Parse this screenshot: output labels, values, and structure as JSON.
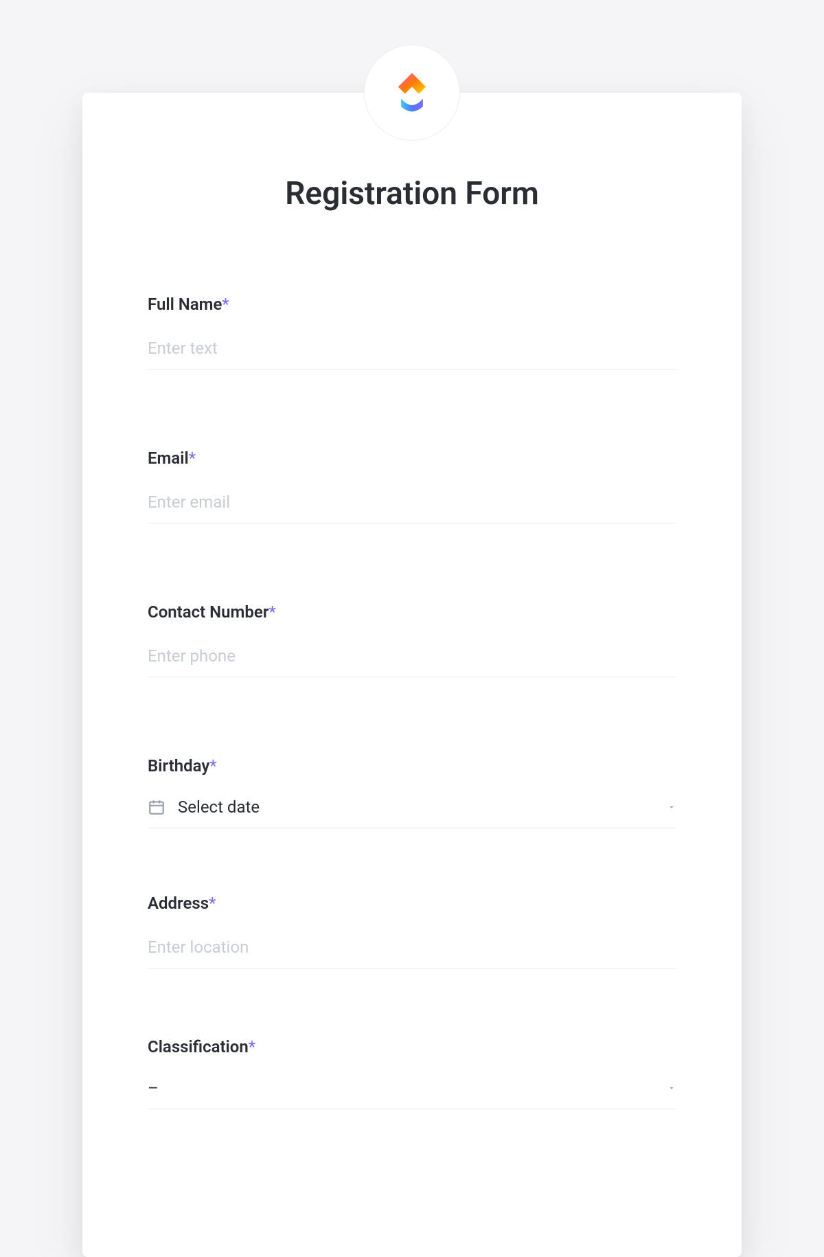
{
  "form": {
    "title": "Registration Form",
    "required_marker": "*",
    "fields": {
      "full_name": {
        "label": "Full Name",
        "placeholder": "Enter text",
        "required": true
      },
      "email": {
        "label": "Email",
        "placeholder": "Enter email",
        "required": true
      },
      "contact_number": {
        "label": "Contact Number",
        "placeholder": "Enter phone",
        "required": true
      },
      "birthday": {
        "label": "Birthday",
        "placeholder": "Select date",
        "required": true
      },
      "address": {
        "label": "Address",
        "placeholder": "Enter location",
        "required": true
      },
      "classification": {
        "label": "Classification",
        "placeholder": "–",
        "required": true
      }
    }
  },
  "colors": {
    "accent": "#7b68ee",
    "text_primary": "#2a2e34",
    "placeholder": "#c8ccd4",
    "border": "#e8eaed"
  }
}
